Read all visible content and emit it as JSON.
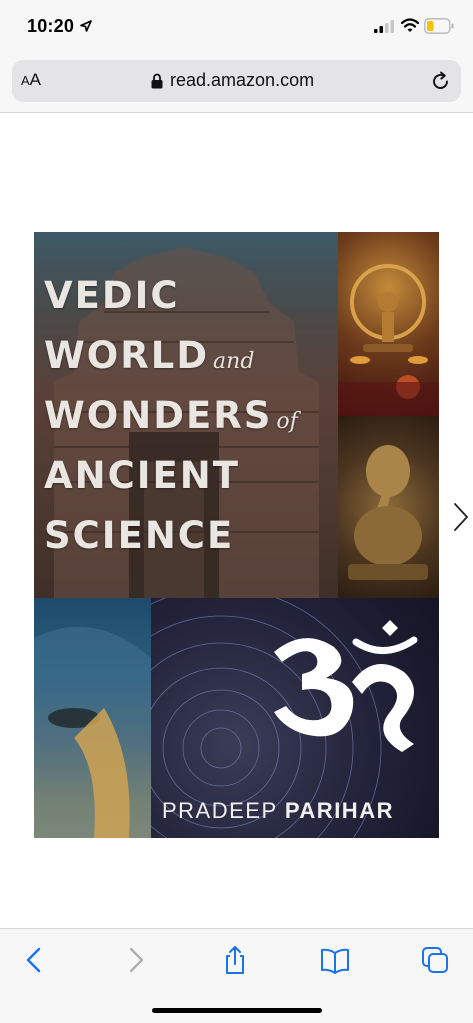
{
  "status_bar": {
    "time": "10:20",
    "icons": [
      "location-arrow-icon",
      "cellular-signal-icon",
      "wifi-icon",
      "battery-low-icon"
    ],
    "battery_color": "#f5c400"
  },
  "url_bar": {
    "text_size_label_small": "A",
    "text_size_label_large": "A",
    "url": "read.amazon.com",
    "icons": [
      "lock-icon",
      "reload-icon"
    ]
  },
  "book_cover": {
    "title_lines": [
      "VEDIC",
      "WORLD",
      "and",
      "WONDERS",
      "of",
      "ANCIENT",
      "SCIENCE"
    ],
    "author_first": "PRADEEP",
    "author_last": "PARIHAR",
    "images": [
      "temple-photo",
      "nataraja-statue-photo",
      "ganesha-statue-photo",
      "elephant-statue-photo",
      "star-trails-photo",
      "om-symbol"
    ]
  },
  "reader": {
    "icons": [
      "chevron-right-icon"
    ]
  },
  "toolbar": {
    "accent_color": "#1a73e8",
    "disabled_color": "#b0b0b0",
    "icons": [
      "back-icon",
      "forward-icon",
      "share-icon",
      "bookmarks-icon",
      "tabs-icon"
    ]
  }
}
